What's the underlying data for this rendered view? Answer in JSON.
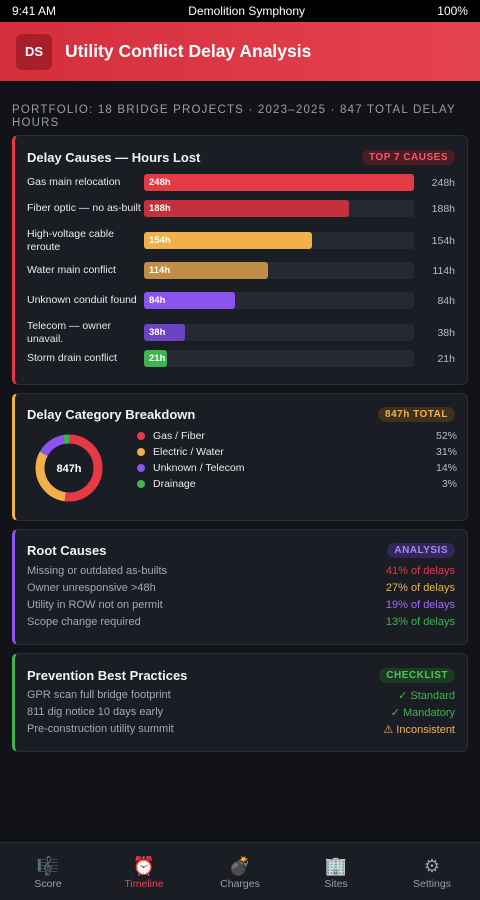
{
  "status": {
    "time": "9:41 AM",
    "app": "Demolition Symphony",
    "battery": "100%"
  },
  "header": {
    "logo": "DS",
    "title": "Utility Conflict Delay Analysis"
  },
  "summary": "PORTFOLIO: 18 BRIDGE PROJECTS · 2023–2025 · 847 TOTAL DELAY HOURS",
  "causes": {
    "title": "Delay Causes — Hours Lost",
    "badge": "TOP 7 CAUSES",
    "max": 248,
    "items": [
      {
        "label": "Gas main relocation",
        "value": 248,
        "bar": "248h",
        "val": "248h",
        "color": "#e63946"
      },
      {
        "label": "Fiber optic — no as-built",
        "value": 188,
        "bar": "188h",
        "val": "188h",
        "color": "#c4303c"
      },
      {
        "label": "High-voltage cable reroute",
        "value": 154,
        "bar": "154h",
        "val": "154h",
        "color": "#f2b04a"
      },
      {
        "label": "Water main conflict",
        "value": 114,
        "bar": "114h",
        "val": "114h",
        "color": "#c18e46"
      },
      {
        "label": "Unknown conduit found",
        "value": 84,
        "bar": "84h",
        "val": "84h",
        "color": "#8b54f0"
      },
      {
        "label": "Telecom — owner unavail.",
        "value": 38,
        "bar": "38h",
        "val": "38h",
        "color": "#6b44c4"
      },
      {
        "label": "Storm drain conflict",
        "value": 21,
        "bar": "21h",
        "val": "21h",
        "color": "#3fb34f"
      }
    ]
  },
  "breakdown": {
    "title": "Delay Category Breakdown",
    "badge": "847h TOTAL",
    "center": "847h",
    "items": [
      {
        "label": "Gas / Fiber",
        "pct": "52%",
        "value": 52,
        "color": "#e63946"
      },
      {
        "label": "Electric / Water",
        "pct": "31%",
        "value": 31,
        "color": "#f2b04a"
      },
      {
        "label": "Unknown / Telecom",
        "pct": "14%",
        "value": 14,
        "color": "#8b54f0"
      },
      {
        "label": "Drainage",
        "pct": "3%",
        "value": 3,
        "color": "#3fb34f"
      }
    ]
  },
  "root": {
    "title": "Root Causes",
    "badge": "ANALYSIS",
    "items": [
      {
        "label": "Missing or outdated as-builts",
        "value": "41% of delays",
        "color": "#e63946"
      },
      {
        "label": "Owner unresponsive >48h",
        "value": "27% of delays",
        "color": "#f2b04a"
      },
      {
        "label": "Utility in ROW not on permit",
        "value": "19% of delays",
        "color": "#a06cf5"
      },
      {
        "label": "Scope change required",
        "value": "13% of delays",
        "color": "#3fb34f"
      }
    ]
  },
  "prevention": {
    "title": "Prevention Best Practices",
    "badge": "CHECKLIST",
    "items": [
      {
        "label": "GPR scan full bridge footprint",
        "value": "✓ Standard",
        "color": "#3fb34f"
      },
      {
        "label": "811 dig notice 10 days early",
        "value": "✓ Mandatory",
        "color": "#3fb34f"
      },
      {
        "label": "Pre-construction utility summit",
        "value": "⚠ Inconsistent",
        "color": "#f2b04a"
      }
    ]
  },
  "nav": [
    {
      "icon": "🎼",
      "icon_name": "score-icon",
      "label": "Score"
    },
    {
      "icon": "⏰",
      "icon_name": "timeline-icon",
      "label": "Timeline",
      "active": true
    },
    {
      "icon": "💣",
      "icon_name": "charges-icon",
      "label": "Charges"
    },
    {
      "icon": "🏢",
      "icon_name": "sites-icon",
      "label": "Sites"
    },
    {
      "icon": "⚙",
      "icon_name": "settings-icon",
      "label": "Settings"
    }
  ]
}
